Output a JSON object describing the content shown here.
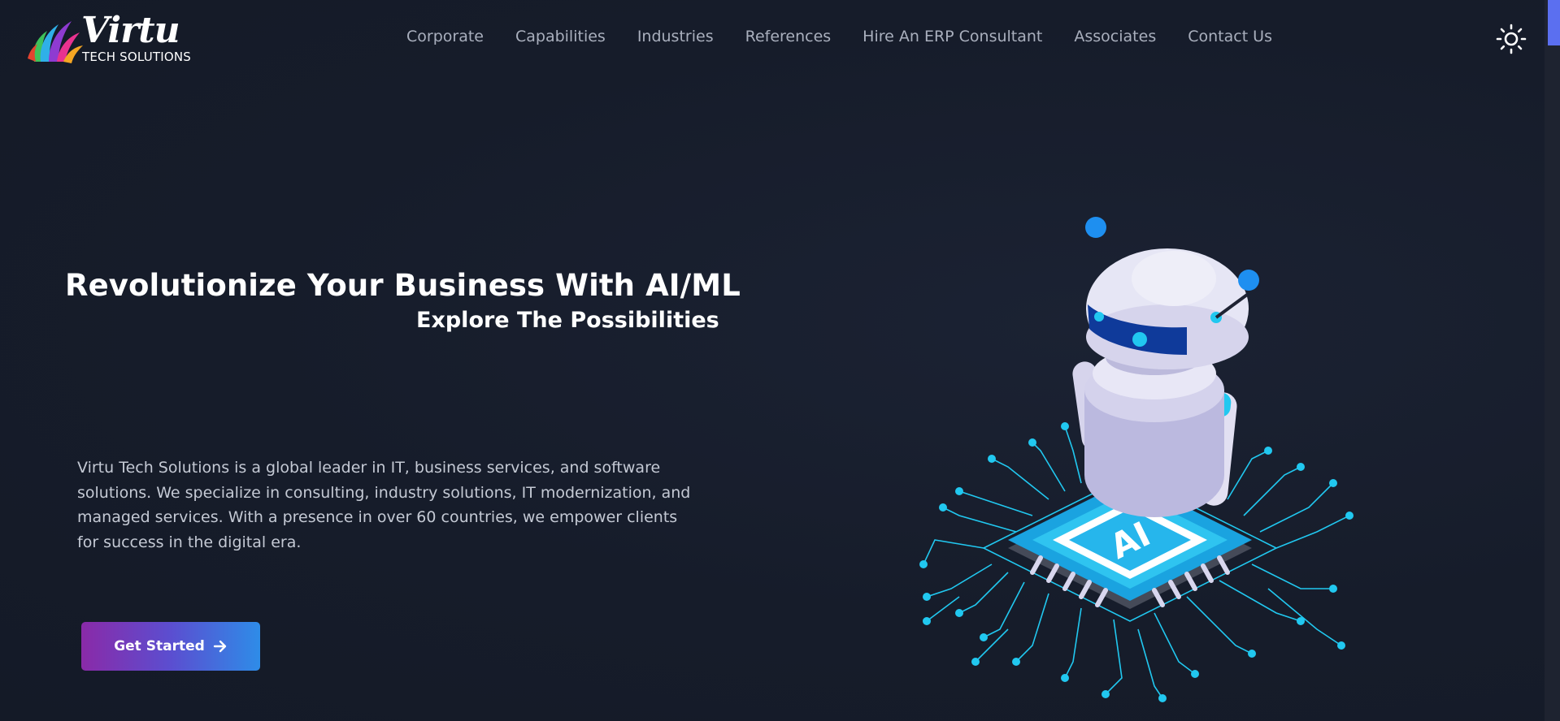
{
  "brand": {
    "wordmark": "Virtu",
    "tagline": "TECH SOLUTIONS",
    "colors": [
      "#e3432f",
      "#f5a623",
      "#8e3bd1",
      "#2fb0e8",
      "#3ec25a",
      "#e8328f"
    ]
  },
  "nav": {
    "items": [
      {
        "label": "Corporate"
      },
      {
        "label": "Capabilities"
      },
      {
        "label": "Industries"
      },
      {
        "label": "References"
      },
      {
        "label": "Hire An ERP Consultant"
      },
      {
        "label": "Associates"
      },
      {
        "label": "Contact Us"
      }
    ],
    "theme_toggle_icon": "sun-icon"
  },
  "hero": {
    "title": "Revolutionize Your Business With AI/ML",
    "subtitle": "Explore The Possibilities",
    "description": "Virtu Tech Solutions is a global leader in IT, business services, and software solutions. We specialize in consulting, industry solutions, IT modernization, and managed services. With a presence in over 60 countries, we empower clients for success in the digital era.",
    "cta_label": "Get Started",
    "cta_icon": "arrow-right-icon",
    "illustration": {
      "chip_label": "AI",
      "accent": "#21c8f0",
      "robot_body": "#e6e6f5"
    }
  },
  "colors": {
    "background": "#161c2a",
    "nav_text": "#a9afbd",
    "cta_gradient_start": "#8a2aa8",
    "cta_gradient_end": "#2e8ce8",
    "scroll_thumb": "#5b6ff0"
  }
}
